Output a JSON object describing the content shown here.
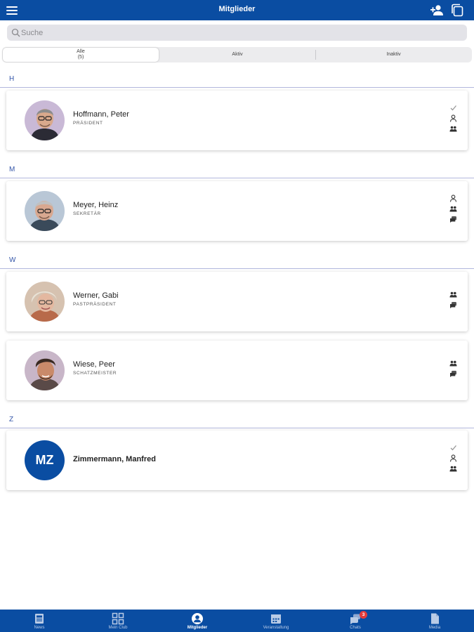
{
  "header": {
    "title": "Mitglieder",
    "menu_icon": "menu-icon",
    "add_icon": "add-person-icon",
    "copy_icon": "copy-icon"
  },
  "search": {
    "placeholder": "Suche",
    "value": ""
  },
  "filters": [
    {
      "label": "Alle",
      "count": "(5)",
      "active": true
    },
    {
      "label": "Aktiv",
      "active": false
    },
    {
      "label": "Inaktiv",
      "active": false
    }
  ],
  "sections": [
    {
      "letter": "H",
      "members": [
        {
          "name": "Hoffmann, Peter",
          "role": "PRÄSIDENT",
          "icons": [
            "check-icon",
            "person-icon",
            "group-icon"
          ]
        }
      ]
    },
    {
      "letter": "M",
      "members": [
        {
          "name": "Meyer, Heinz",
          "role": "SEKRETÄR",
          "icons": [
            "person-icon",
            "group-icon",
            "chat-icon"
          ]
        }
      ]
    },
    {
      "letter": "W",
      "members": [
        {
          "name": "Werner, Gabi",
          "role": "PASTPRÄSIDENT",
          "icons": [
            "group-icon",
            "chat-icon"
          ]
        },
        {
          "name": "Wiese, Peer",
          "role": "SCHATZMEISTER",
          "icons": [
            "group-icon",
            "chat-icon"
          ]
        }
      ]
    },
    {
      "letter": "Z",
      "members": [
        {
          "name": "Zimmermann, Manfred",
          "role": "",
          "initials": "MZ",
          "icons": [
            "check-icon",
            "person-icon",
            "group-icon"
          ]
        }
      ]
    }
  ],
  "tabs": [
    {
      "label": "News",
      "icon": "news-icon",
      "active": false
    },
    {
      "label": "Mein Club",
      "icon": "grid-icon",
      "active": false
    },
    {
      "label": "Mitglieder",
      "icon": "member-icon",
      "active": true
    },
    {
      "label": "Veranstaltung",
      "icon": "calendar-icon",
      "active": false
    },
    {
      "label": "Chats",
      "icon": "chat-bubble-icon",
      "active": false,
      "badge": "3"
    },
    {
      "label": "Media",
      "icon": "document-icon",
      "active": false
    }
  ],
  "colors": {
    "primary": "#0a4da2",
    "section_line": "#b2b7dd",
    "badge": "#e23b3b"
  }
}
